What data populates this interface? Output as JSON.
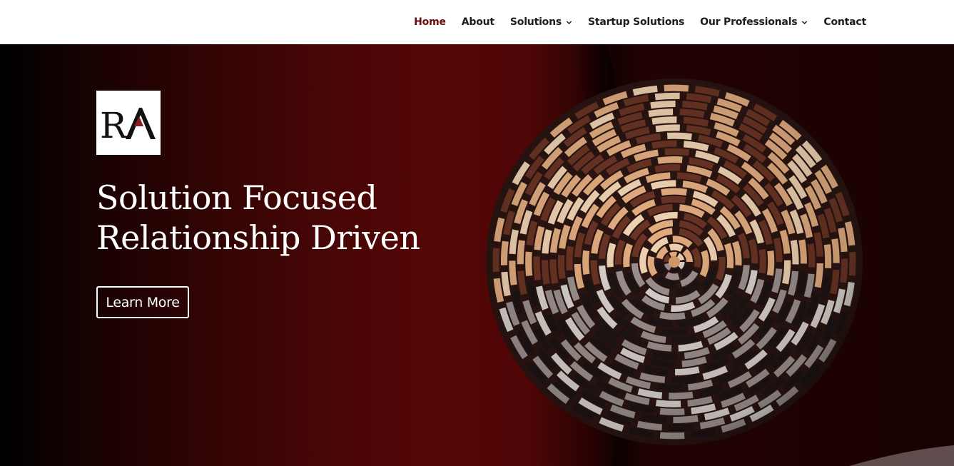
{
  "nav": {
    "items": [
      {
        "label": "Home",
        "active": true,
        "has_dropdown": false
      },
      {
        "label": "About",
        "active": false,
        "has_dropdown": false
      },
      {
        "label": "Solutions",
        "active": false,
        "has_dropdown": true
      },
      {
        "label": "Startup Solutions",
        "active": false,
        "has_dropdown": false
      },
      {
        "label": "Our Professionals",
        "active": false,
        "has_dropdown": true
      },
      {
        "label": "Contact",
        "active": false,
        "has_dropdown": false
      }
    ],
    "chevron_icon": "chevron-down-icon",
    "active_color": "#6b0b0b",
    "text_color": "#1c1c1c"
  },
  "hero": {
    "logo": {
      "letters": "RA",
      "icon": "ra-logo"
    },
    "headline_line1": "Solution Focused",
    "headline_line2": "Relationship Driven",
    "cta_label": "Learn More",
    "image": "woven-basket-image",
    "colors": {
      "background_dark": "#000000",
      "background_red": "#560707",
      "accent": "#8b1a1a",
      "text": "#ffffff"
    }
  }
}
